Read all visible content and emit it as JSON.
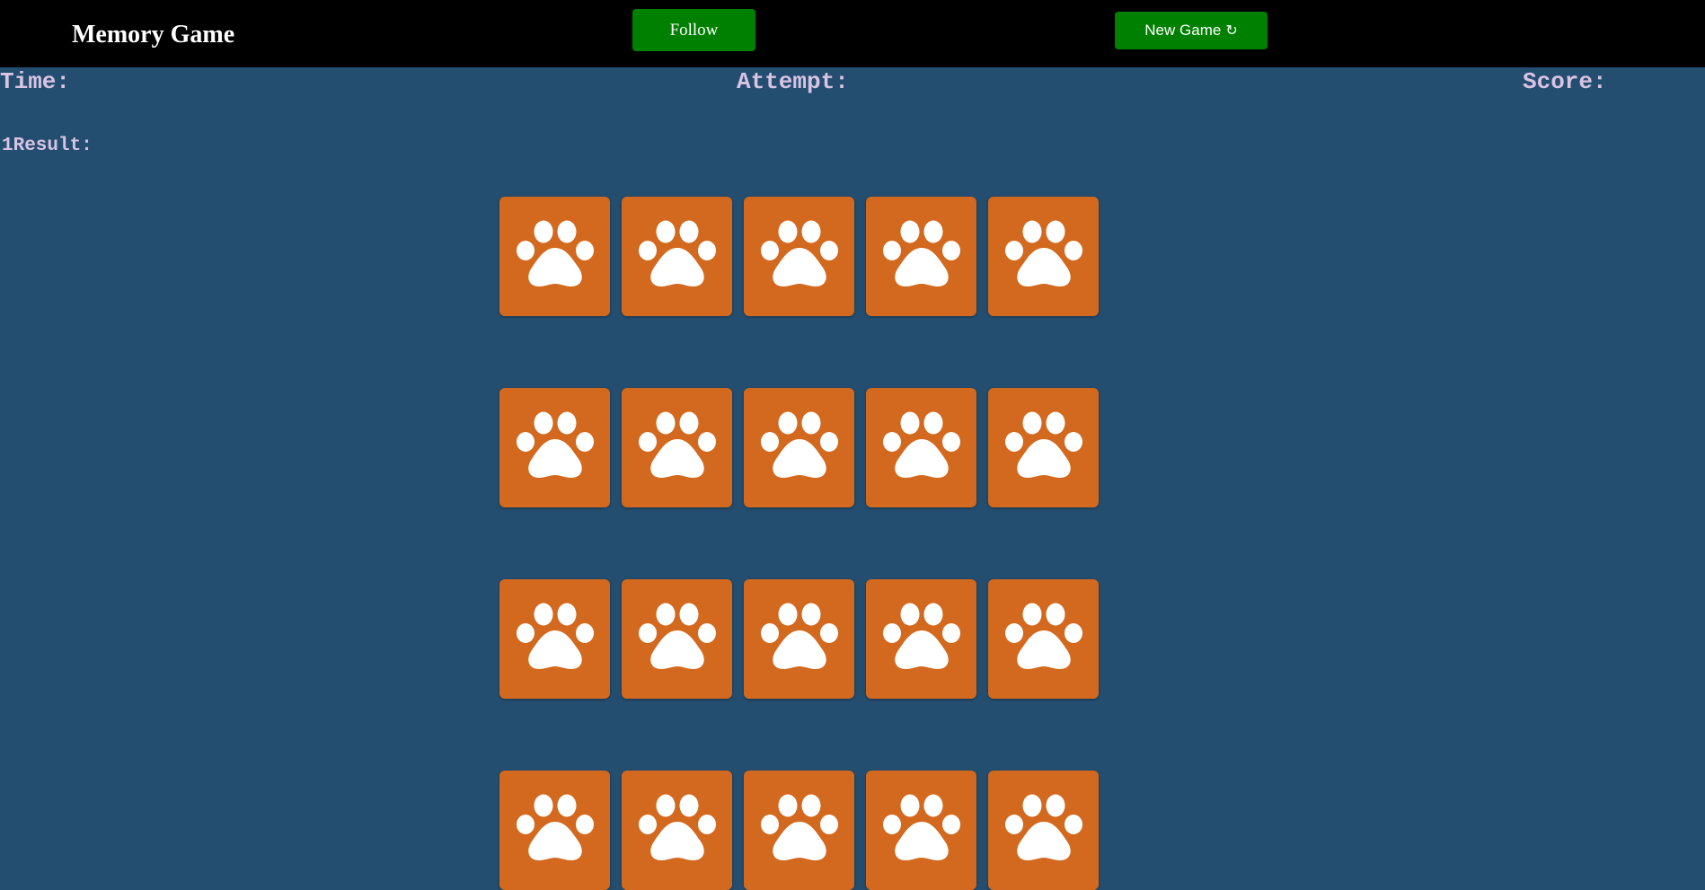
{
  "header": {
    "title": "Memory Game",
    "follow_label": "Follow",
    "new_game_label": "New Game",
    "new_game_icon": "↻"
  },
  "stats": {
    "time_label": "Time:",
    "attempt_label": "Attempt:",
    "score_label": "Score:",
    "result_label": "1Result:"
  },
  "board": {
    "rows": 4,
    "columns": 5,
    "card_state": "face-down",
    "card_icon": "paw-icon"
  },
  "colors": {
    "background": "#244e70",
    "header": "#000000",
    "button": "#008000",
    "card": "#d2691e",
    "label_text": "#d8c3e3"
  }
}
